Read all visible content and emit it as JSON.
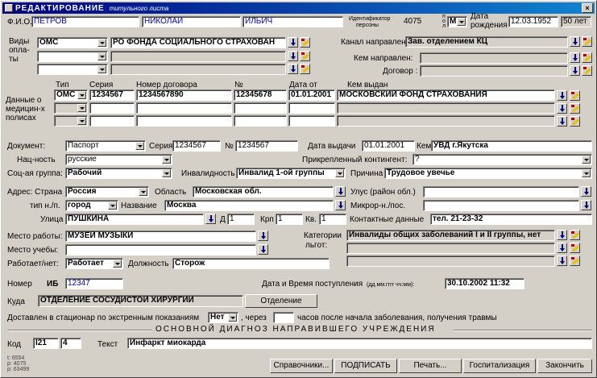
{
  "title": {
    "main": "РЕДАКТИРОВАНИЕ",
    "sub": "титульного листа"
  },
  "fio": {
    "label": "Ф.И.О.",
    "last": "ПЕТРОВ",
    "first": "НИКОЛАЙ",
    "middle": "ИЛЬИЧ"
  },
  "ident": {
    "label1": "Идентификатор",
    "label2": "персоны",
    "value": "4075"
  },
  "sex": {
    "label_p": "п",
    "label_o": "о",
    "label_l": "л",
    "value": "М"
  },
  "birth": {
    "label1": "Дата",
    "label2": "рождения",
    "value": "12.03.1952",
    "age": "50 лет"
  },
  "payment": {
    "label1": "Виды",
    "label2": "опла-",
    "label3": "ты",
    "type1": "ОМС",
    "desc1": "РО ФОНДА СОЦИАЛЬНОГО СТРАХОВАН"
  },
  "channel": {
    "label": "Канал направления:",
    "value": "Зав. отделением КЦ",
    "sender_label": "Кем направлен:",
    "contract_label": "Договор :"
  },
  "policy": {
    "label1": "Данные о",
    "label2": "медицин-х",
    "label3": "полисах",
    "col_type": "Тип",
    "col_series": "Серия",
    "col_number": "Номер договора",
    "col_no": "№",
    "col_date": "Дата от",
    "col_issuer": "Кем выдан",
    "type": "ОМС",
    "series": "1234567",
    "contract": "1234567890",
    "number": "12345678",
    "date": "01.01.2001",
    "issuer": "МОСКОВСКИЙ ФОНД СТРАХОВАНИЯ"
  },
  "document": {
    "label": "Документ:",
    "type": "Паспорт",
    "series_label": "Серия",
    "series": "1234567",
    "no_label": "№",
    "number": "1234567",
    "date_label": "Дата выдачи",
    "date": "01.01.2001",
    "issuer_label": "Кем",
    "issuer": "УВД г.Якутска"
  },
  "nationality": {
    "label": "Нац-ность",
    "value": "русские"
  },
  "contingent": {
    "label": "Прикрепленный контингент:",
    "value": "?"
  },
  "social": {
    "label": "Соц-ая группа:",
    "value": "Рабочий"
  },
  "disability": {
    "label": "Инвалидность",
    "value": "Инвалид 1-ой группы"
  },
  "reason": {
    "label": "Причина",
    "value": "Трудовое увечье"
  },
  "address": {
    "country_label": "Адрес: Страна",
    "country": "Россия",
    "region_label": "Область",
    "region": "Московская обл.",
    "ulus_label": "Улус (район обл.)",
    "type_label": "тип н./п.",
    "type": "город",
    "name_label": "Название",
    "name": "Москва",
    "micro_label": "Микрор-н./пос.",
    "street_label": "Улица",
    "street": "ПУШКИНА",
    "house_label": "Д",
    "house": "1",
    "korp_label": "Крп",
    "korp": "1",
    "kv_label": "Кв.",
    "kv": "1",
    "contacts_label": "Контактные данные",
    "contacts": "тел. 21-23-32"
  },
  "work": {
    "place_label": "Место работы:",
    "place": "МУЗЕЙ МУЗЫКИ",
    "study_label": "Место учебы:",
    "works_label": "Работает/нет:",
    "works": "Работает",
    "position_label": "Должность",
    "position": "Сторож"
  },
  "benefits": {
    "label1": "Категории",
    "label2": "льгот:",
    "value": "Инвалиды общих заболеваний I и II группы, нет"
  },
  "record": {
    "number_label": "Номер",
    "ib_label": "ИБ",
    "number": "12347",
    "admit_label": "Дата и Время поступления",
    "admit_fmt": "(дд.мм.гггг чч:мм):",
    "admit": "30.10.2002 11:32"
  },
  "dept": {
    "label": "Куда",
    "value": "ОТДЕЛЕНИЕ СОСУДИСТОЙ ХИРУРГИИ",
    "button": "Отделение"
  },
  "emergency": {
    "text1": "Доставлен в стационар по экстренным показаниям",
    "value": "Нет",
    "text2": ", через",
    "text3": "часов после начала заболевания, получения травмы"
  },
  "diagnosis": {
    "header": "ОСНОВНОЙ ДИАГНОЗ НАПРАВИВШЕГО УЧРЕЖДЕНИЯ",
    "code_label": "Код",
    "code": "I21",
    "code2": "4",
    "text_label": "Текст",
    "text": "Инфаркт миокарда"
  },
  "corner": {
    "l1": "t: 6554",
    "l2": "p: 4075",
    "l3": "p: 63499"
  },
  "buttons": {
    "ref": "Справочники...",
    "sign": "ПОДПИСАТЬ",
    "print": "Печать...",
    "hosp": "Госпитализация",
    "finish": "Закончить"
  }
}
